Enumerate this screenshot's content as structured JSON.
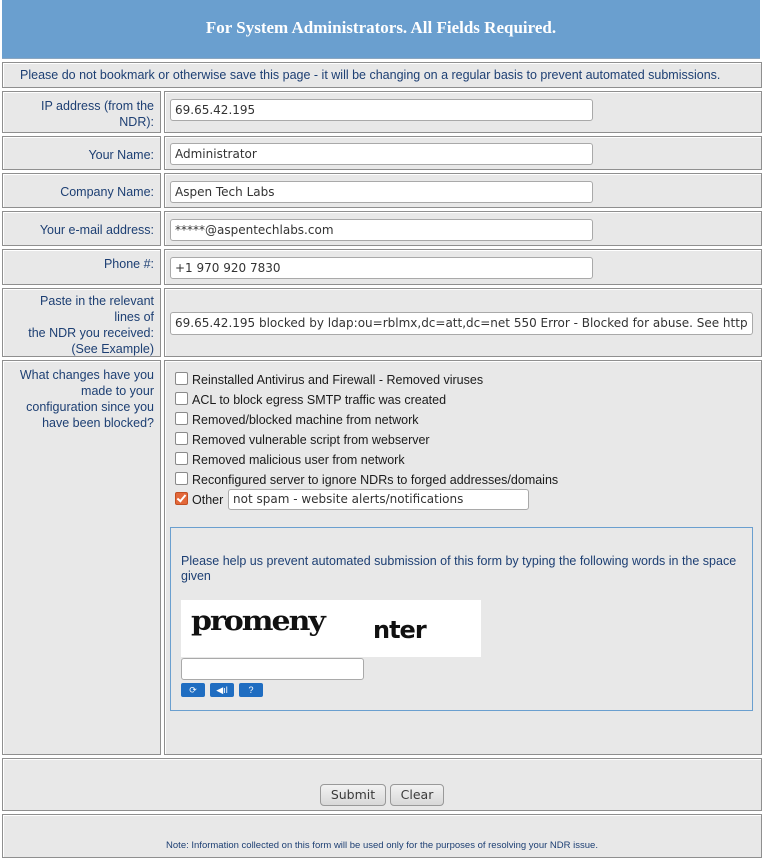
{
  "header": {
    "title": "For System Administrators. All Fields Required."
  },
  "notice": "Please do not bookmark or otherwise save this page - it will be changing on a regular basis to prevent automated submissions.",
  "fields": {
    "ip": {
      "label": "IP address (from the NDR):",
      "value": "69.65.42.195"
    },
    "name": {
      "label": "Your Name:",
      "value": "Administrator"
    },
    "company": {
      "label": "Company Name:",
      "value": "Aspen Tech Labs"
    },
    "email": {
      "label": "Your e-mail address:",
      "value": "*****@aspentechlabs.com"
    },
    "phone": {
      "label": "Phone #:",
      "value": "+1 970 920 7830"
    },
    "ndr": {
      "label_lines": [
        "Paste in the relevant",
        "lines of",
        "the NDR you received:",
        "(See Example)"
      ],
      "value": "69.65.42.195 blocked by ldap:ou=rblmx,dc=att,dc=net    550 Error - Blocked for abuse. See http"
    }
  },
  "changes": {
    "label": "What changes have you made to your configuration since you have been blocked?",
    "options": [
      {
        "label": "Reinstalled Antivirus and Firewall - Removed viruses",
        "checked": false
      },
      {
        "label": "ACL to block egress SMTP traffic was created",
        "checked": false
      },
      {
        "label": "Removed/blocked machine from network",
        "checked": false
      },
      {
        "label": "Removed vulnerable script from webserver",
        "checked": false
      },
      {
        "label": "Removed malicious user from network",
        "checked": false
      },
      {
        "label": "Reconfigured server to ignore NDRs to forged addresses/domains",
        "checked": false
      },
      {
        "label": "Other",
        "checked": true
      }
    ],
    "other_value": "not spam - website alerts/notifications"
  },
  "captcha": {
    "instructions": "Please help us prevent automated submission of this form by typing the following words in the space given",
    "word1": "promeny",
    "word2": "nter",
    "input_value": "",
    "buttons": {
      "refresh": "⟳",
      "audio": "◀ıl",
      "help": "?"
    }
  },
  "actions": {
    "submit": "Submit",
    "clear": "Clear"
  },
  "footer_note": "Note: Information collected on this form will be used only for the purposes of resolving your NDR issue."
}
